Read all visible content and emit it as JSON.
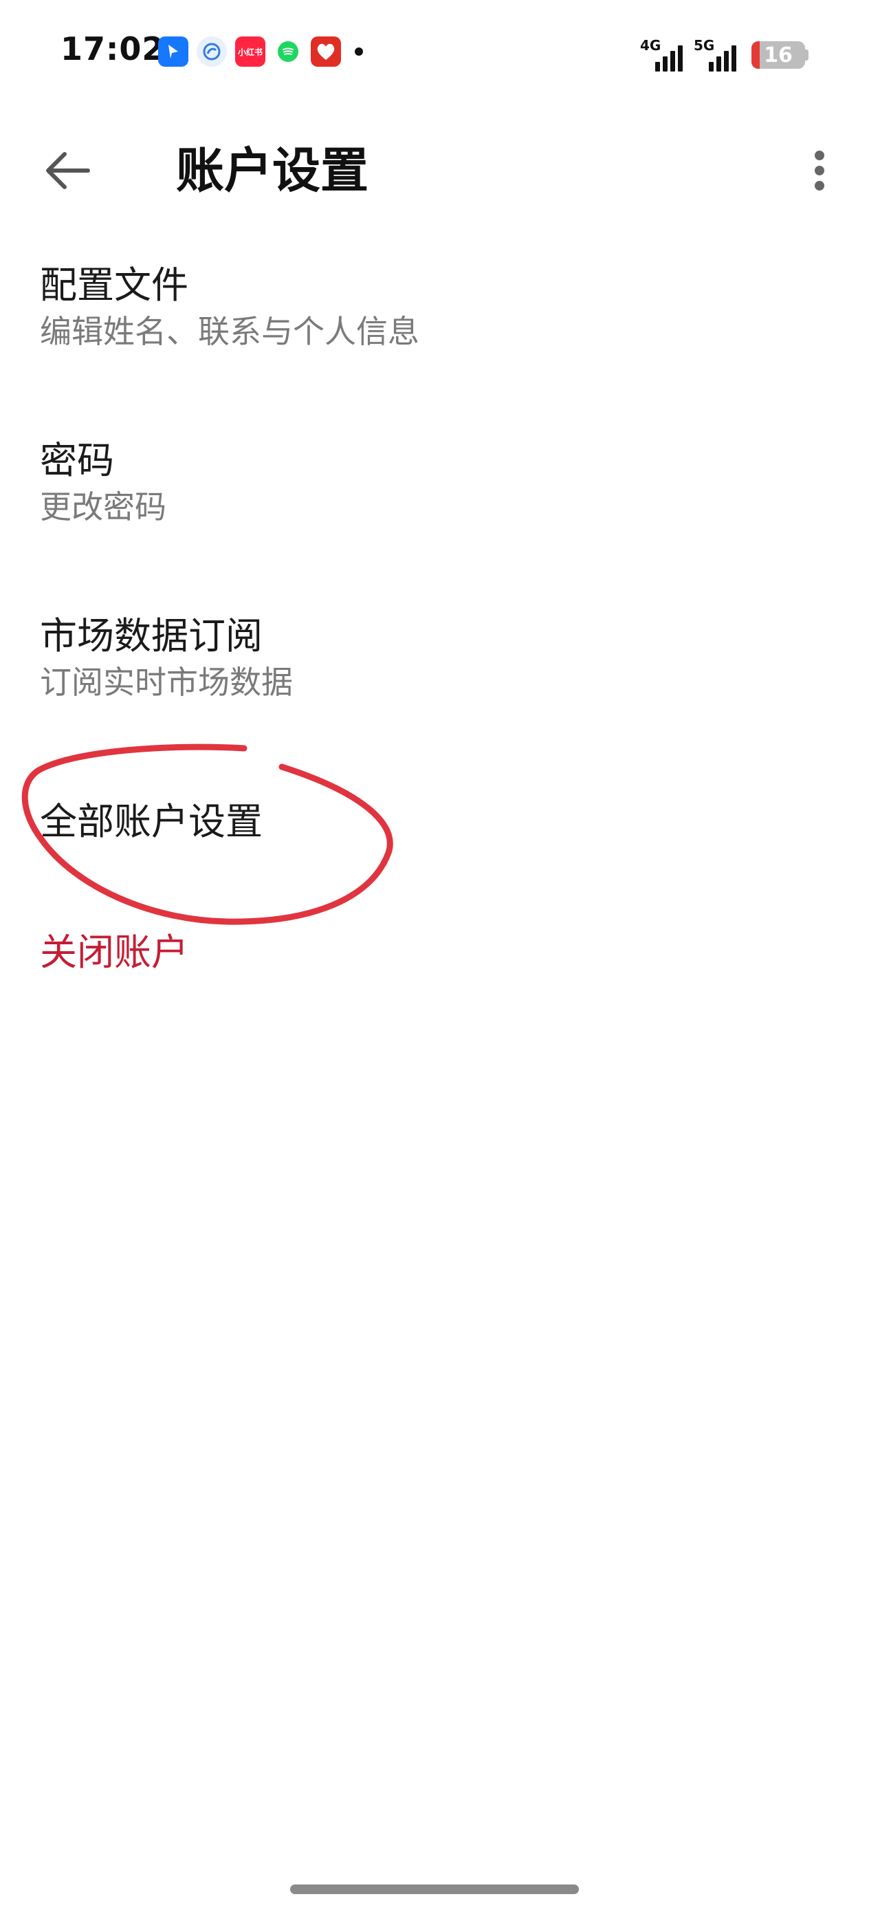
{
  "status_bar": {
    "time": "17:02",
    "notification_icons": [
      "alipay-icon",
      "circle-app-icon",
      "xiaohongshu-icon",
      "spotify-icon",
      "pinduoduo-icon"
    ],
    "xiaohongshu_text": "小红书",
    "network_1": "4G",
    "network_2": "5G",
    "battery_level": "16",
    "battery_fraction": 0.16
  },
  "app_bar": {
    "title": "账户设置",
    "back_icon": "arrow-left-icon",
    "more_icon": "more-vertical-icon"
  },
  "settings": {
    "profile": {
      "title": "配置文件",
      "subtitle": "编辑姓名、联系与个人信息"
    },
    "password": {
      "title": "密码",
      "subtitle": "更改密码"
    },
    "market_data": {
      "title": "市场数据订阅",
      "subtitle": "订阅实时市场数据"
    },
    "all_account_settings": {
      "title": "全部账户设置"
    },
    "close_account": {
      "title": "关闭账户"
    }
  },
  "colors": {
    "danger_text": "#c41e35",
    "annotation_stroke": "#e0343f",
    "subtitle_text": "#7a7a7a"
  }
}
